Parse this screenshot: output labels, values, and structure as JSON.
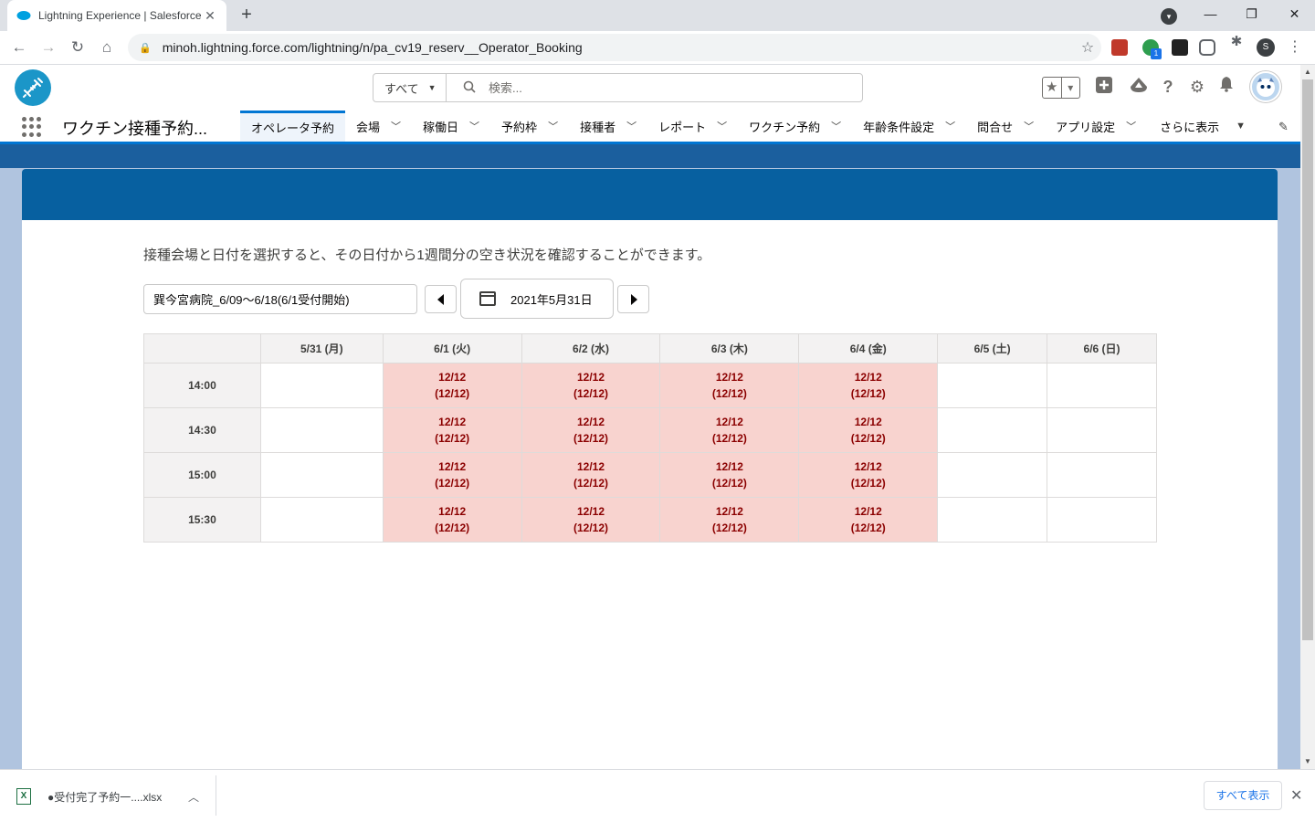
{
  "browser": {
    "tab_title": "Lightning Experience | Salesforce",
    "url": "minoh.lightning.force.com/lightning/n/pa_cv19_reserv__Operator_Booking",
    "profile_initial": "S",
    "extension_badge": "1"
  },
  "header": {
    "search_scope": "すべて",
    "search_placeholder": "検索..."
  },
  "nav": {
    "app_name": "ワクチン接種予約...",
    "items": [
      {
        "label": "オペレータ予約",
        "active": true,
        "has_menu": false
      },
      {
        "label": "会場",
        "has_menu": true
      },
      {
        "label": "稼働日",
        "has_menu": true
      },
      {
        "label": "予約枠",
        "has_menu": true
      },
      {
        "label": "接種者",
        "has_menu": true
      },
      {
        "label": "レポート",
        "has_menu": true
      },
      {
        "label": "ワクチン予約",
        "has_menu": true
      },
      {
        "label": "年齢条件設定",
        "has_menu": true
      },
      {
        "label": "問合せ",
        "has_menu": true
      },
      {
        "label": "アプリ設定",
        "has_menu": true
      }
    ],
    "more_label": "さらに表示"
  },
  "booking": {
    "instruction": "接種会場と日付を選択すると、その日付から1週間分の空き状況を確認することができます。",
    "venue": "巽今宮病院_6/09～6/18(6/1受付開始)",
    "date": "2021年5月31日",
    "columns": [
      "5/31 (月)",
      "6/1 (火)",
      "6/2 (水)",
      "6/3 (木)",
      "6/4 (金)",
      "6/5 (土)",
      "6/6 (日)"
    ],
    "rows": [
      {
        "time": "14:00",
        "cells": [
          "",
          "12/12\n(12/12)",
          "12/12\n(12/12)",
          "12/12\n(12/12)",
          "12/12\n(12/12)",
          "",
          ""
        ]
      },
      {
        "time": "14:30",
        "cells": [
          "",
          "12/12\n(12/12)",
          "12/12\n(12/12)",
          "12/12\n(12/12)",
          "12/12\n(12/12)",
          "",
          ""
        ]
      },
      {
        "time": "15:00",
        "cells": [
          "",
          "12/12\n(12/12)",
          "12/12\n(12/12)",
          "12/12\n(12/12)",
          "12/12\n(12/12)",
          "",
          ""
        ]
      },
      {
        "time": "15:30",
        "cells": [
          "",
          "12/12\n(12/12)",
          "12/12\n(12/12)",
          "12/12\n(12/12)",
          "12/12\n(12/12)",
          "",
          ""
        ]
      }
    ]
  },
  "downloads": {
    "file_name": "●受付完了予約一....xlsx",
    "show_all": "すべて表示"
  },
  "colors": {
    "brand_blue": "#0760a0",
    "full_cell_bg": "#f8d3cf",
    "full_cell_text": "#8b0000"
  }
}
